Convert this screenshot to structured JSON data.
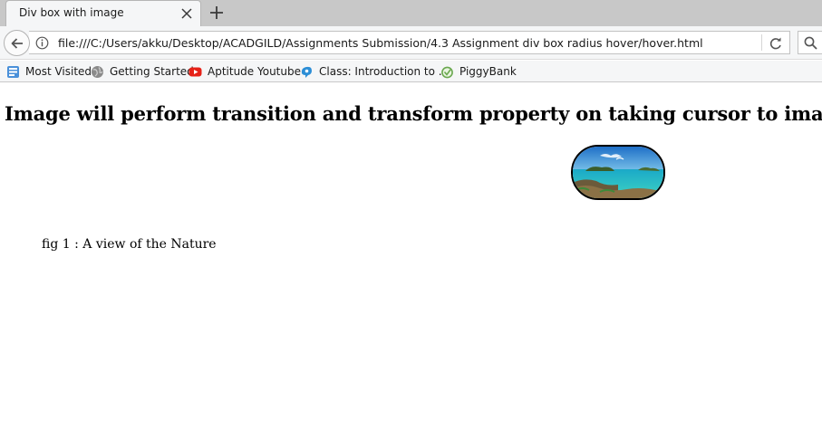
{
  "browser": {
    "tab": {
      "title": "Div box with image"
    },
    "url": "file:///C:/Users/akku/Desktop/ACADGILD/Assignments Submission/4.3 Assignment div box radius hover/hover.html",
    "bookmarks": [
      {
        "label": "Most Visited",
        "icon": "most-visited-icon"
      },
      {
        "label": "Getting Started",
        "icon": "globe-icon"
      },
      {
        "label": "Aptitude Youtube",
        "icon": "youtube-icon"
      },
      {
        "label": "Class: Introduction to ...",
        "icon": "class-icon"
      },
      {
        "label": "PiggyBank",
        "icon": "piggybank-icon"
      }
    ]
  },
  "page": {
    "heading": "Image will perform transition and transform property on taking cursor to image",
    "caption": "fig 1 : A view of the Nature"
  }
}
